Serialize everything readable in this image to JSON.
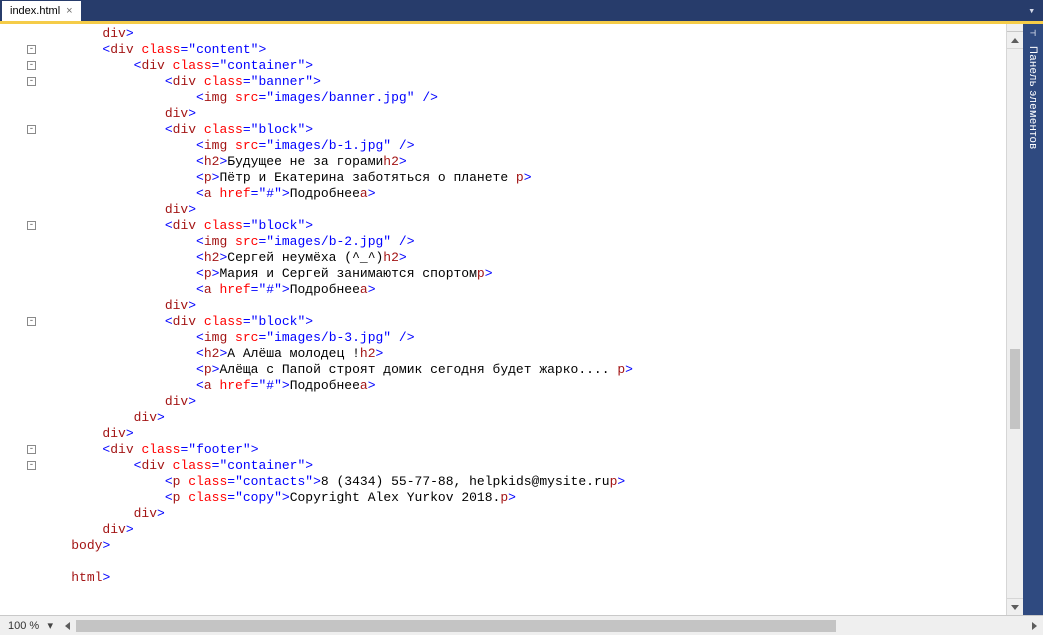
{
  "tab": {
    "title": "index.html",
    "close": "×"
  },
  "sidepanel_label": "Панель элементов",
  "zoom": "100 %",
  "code": {
    "l1": {
      "ind": "        ",
      "o1": "</",
      "t1": "div",
      "c1": ">"
    },
    "l2": {
      "ind": "        ",
      "o1": "<",
      "t1": "div",
      "a1": " class",
      "eq": "=",
      "v1": "\"content\"",
      "c1": ">"
    },
    "l3": {
      "ind": "            ",
      "o1": "<",
      "t1": "div",
      "a1": " class",
      "eq": "=",
      "v1": "\"container\"",
      "c1": ">"
    },
    "l4": {
      "ind": "                ",
      "o1": "<",
      "t1": "div",
      "a1": " class",
      "eq": "=",
      "v1": "\"banner\"",
      "c1": ">"
    },
    "l5": {
      "ind": "                    ",
      "o1": "<",
      "t1": "img",
      "a1": " src",
      "eq": "=",
      "v1": "\"images/banner.jpg\"",
      "sp": " ",
      "c1": "/>"
    },
    "l6": {
      "ind": "                ",
      "o1": "</",
      "t1": "div",
      "c1": ">"
    },
    "l7": {
      "ind": "                ",
      "o1": "<",
      "t1": "div",
      "a1": " class",
      "eq": "=",
      "v1": "\"block\"",
      "c1": ">"
    },
    "l8": {
      "ind": "                    ",
      "o1": "<",
      "t1": "img",
      "a1": " src",
      "eq": "=",
      "v1": "\"images/b-1.jpg\"",
      "sp": " ",
      "c1": "/>"
    },
    "l9": {
      "ind": "                    ",
      "o1": "<",
      "t1": "h2",
      "c1": ">",
      "tx": "Будущее не за горами",
      "o2": "</",
      "t2": "h2",
      "c2": ">"
    },
    "l10": {
      "ind": "                    ",
      "o1": "<",
      "t1": "p",
      "c1": ">",
      "tx": "Пётр и Екатерина заботяться о планете ",
      "o2": "</",
      "t2": "p",
      "c2": ">"
    },
    "l11": {
      "ind": "                    ",
      "o1": "<",
      "t1": "a",
      "a1": " href",
      "eq": "=",
      "v1": "\"#\"",
      "c1": ">",
      "tx": "Подробнее",
      "o2": "</",
      "t2": "a",
      "c2": ">"
    },
    "l12": {
      "ind": "                ",
      "o1": "</",
      "t1": "div",
      "c1": ">"
    },
    "l13": {
      "ind": "                ",
      "o1": "<",
      "t1": "div",
      "a1": " class",
      "eq": "=",
      "v1": "\"block\"",
      "c1": ">"
    },
    "l14": {
      "ind": "                    ",
      "o1": "<",
      "t1": "img",
      "a1": " src",
      "eq": "=",
      "v1": "\"images/b-2.jpg\"",
      "sp": " ",
      "c1": "/>"
    },
    "l15": {
      "ind": "                    ",
      "o1": "<",
      "t1": "h2",
      "c1": ">",
      "tx": "Сергей неумёха (^_^)",
      "o2": "</",
      "t2": "h2",
      "c2": ">"
    },
    "l16": {
      "ind": "                    ",
      "o1": "<",
      "t1": "p",
      "c1": ">",
      "tx": "Мария и Сергей занимаются спортом",
      "o2": "</",
      "t2": "p",
      "c2": ">"
    },
    "l17": {
      "ind": "                    ",
      "o1": "<",
      "t1": "a",
      "a1": " href",
      "eq": "=",
      "v1": "\"#\"",
      "c1": ">",
      "tx": "Подробнее",
      "o2": "</",
      "t2": "a",
      "c2": ">"
    },
    "l18": {
      "ind": "                ",
      "o1": "</",
      "t1": "div",
      "c1": ">"
    },
    "l19": {
      "ind": "                ",
      "o1": "<",
      "t1": "div",
      "a1": " class",
      "eq": "=",
      "v1": "\"block\"",
      "c1": ">"
    },
    "l20": {
      "ind": "                    ",
      "o1": "<",
      "t1": "img",
      "a1": " src",
      "eq": "=",
      "v1": "\"images/b-3.jpg\"",
      "sp": " ",
      "c1": "/>"
    },
    "l21": {
      "ind": "                    ",
      "o1": "<",
      "t1": "h2",
      "c1": ">",
      "tx": "А Алёша молодец !",
      "o2": "</",
      "t2": "h2",
      "c2": ">"
    },
    "l22": {
      "ind": "                    ",
      "o1": "<",
      "t1": "p",
      "c1": ">",
      "tx": "Алёща с Папой строят домик сегодня будет жарко.... ",
      "o2": "</",
      "t2": "p",
      "c2": ">"
    },
    "l23": {
      "ind": "                    ",
      "o1": "<",
      "t1": "a",
      "a1": " href",
      "eq": "=",
      "v1": "\"#\"",
      "c1": ">",
      "tx": "Подробнее",
      "o2": "</",
      "t2": "a",
      "c2": ">"
    },
    "l24": {
      "ind": "                ",
      "o1": "</",
      "t1": "div",
      "c1": ">"
    },
    "l25": {
      "ind": "            ",
      "o1": "</",
      "t1": "div",
      "c1": ">"
    },
    "l26": {
      "ind": "        ",
      "o1": "</",
      "t1": "div",
      "c1": ">"
    },
    "l27": {
      "ind": "        ",
      "o1": "<",
      "t1": "div",
      "a1": " class",
      "eq": "=",
      "v1": "\"footer\"",
      "c1": ">"
    },
    "l28": {
      "ind": "            ",
      "o1": "<",
      "t1": "div",
      "a1": " class",
      "eq": "=",
      "v1": "\"container\"",
      "c1": ">"
    },
    "l29": {
      "ind": "                ",
      "o1": "<",
      "t1": "p",
      "a1": " class",
      "eq": "=",
      "v1": "\"contacts\"",
      "c1": ">",
      "tx": "8 (3434) 55-77-88, helpkids@mysite.ru",
      "o2": "</",
      "t2": "p",
      "c2": ">"
    },
    "l30": {
      "ind": "                ",
      "o1": "<",
      "t1": "p",
      "a1": " class",
      "eq": "=",
      "v1": "\"copy\"",
      "c1": ">",
      "tx": "Copyright Alex Yurkov 2018.",
      "o2": "</",
      "t2": "p",
      "c2": ">"
    },
    "l31": {
      "ind": "            ",
      "o1": "</",
      "t1": "div",
      "c1": ">"
    },
    "l32": {
      "ind": "        ",
      "o1": "</",
      "t1": "div",
      "c1": ">"
    },
    "l33": {
      "ind": "    ",
      "o1": "</",
      "t1": "body",
      "c1": ">"
    },
    "l34": {
      "ind": "    ",
      "tx": ""
    },
    "l35": {
      "ind": "    ",
      "o1": "</",
      "t1": "html",
      "c1": ">"
    }
  },
  "fold_rows": [
    2,
    3,
    4,
    7,
    13,
    19,
    27,
    28
  ]
}
